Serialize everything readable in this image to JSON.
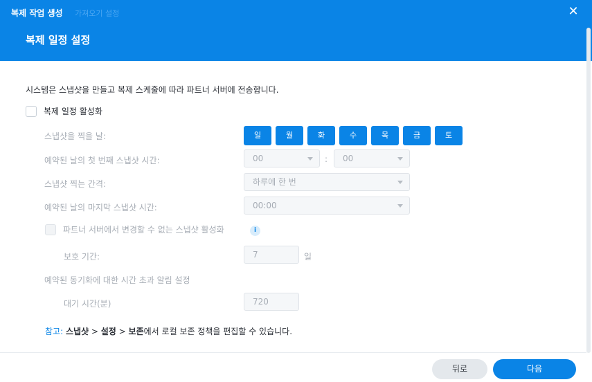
{
  "header": {
    "small_title": "복제 작업 생성",
    "faint_text": "가져오기 설정",
    "step_title": "복제 일정 설정"
  },
  "content": {
    "description": "시스템은 스냅샷을 만들고 복제 스케줄에 따라 파트너 서버에 전송합니다.",
    "enable_schedule_label": "복제 일정 활성화",
    "snapshot_days_label": "스냅샷을 찍을 날:",
    "days": [
      "일",
      "월",
      "화",
      "수",
      "목",
      "금",
      "토"
    ],
    "first_time_label": "예약된 날의 첫 번째 스냅샷 시간:",
    "hour_value": "00",
    "minute_value": "00",
    "colon": ":",
    "interval_label": "스냅샷 찍는 간격:",
    "interval_value": "하루에 한 번",
    "last_time_label": "예약된 날의 마지막 스냅샷 시간:",
    "last_time_value": "00:00",
    "immutable_label": "파트너 서버에서 변경할 수 없는 스냅샷 활성화",
    "info_icon": "i",
    "protection_label": "보호 기간:",
    "protection_value": "7",
    "protection_unit": "일",
    "timeout_label": "예약된 동기화에 대한 시간 초과 알림 설정",
    "wait_label": "대기 시간(분)",
    "wait_value": "720",
    "note_prefix": "참고:",
    "note_snapshot": "스냅샷",
    "note_sep1": " > ",
    "note_settings": "설정",
    "note_sep2": " > ",
    "note_retention": "보존",
    "note_suffix": "에서 로컬 보존 정책을 편집할 수 있습니다."
  },
  "footer": {
    "back_label": "뒤로",
    "next_label": "다음"
  },
  "colors": {
    "accent": "#0a84e6",
    "header_bg": "#0a84e6",
    "disabled_text": "#a7adb5"
  },
  "icons": {
    "close": "close-icon",
    "info": "info-icon",
    "dropdown": "chevron-down-icon"
  }
}
